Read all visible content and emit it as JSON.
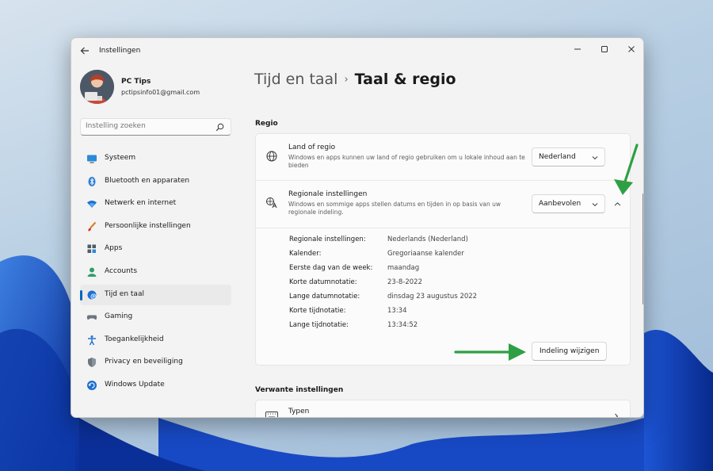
{
  "window": {
    "title": "Instellingen",
    "controls": [
      "minimize-icon",
      "maximize-icon",
      "close-icon"
    ]
  },
  "profile": {
    "name": "PC Tips",
    "email": "pctipsinfo01@gmail.com"
  },
  "search": {
    "placeholder": "Instelling zoeken"
  },
  "sidebar": {
    "items": [
      {
        "label": "Systeem",
        "icon": "monitor-icon",
        "active": false
      },
      {
        "label": "Bluetooth en apparaten",
        "icon": "bluetooth-icon",
        "active": false
      },
      {
        "label": "Netwerk en internet",
        "icon": "wifi-icon",
        "active": false
      },
      {
        "label": "Persoonlijke instellingen",
        "icon": "brush-icon",
        "active": false
      },
      {
        "label": "Apps",
        "icon": "apps-icon",
        "active": false
      },
      {
        "label": "Accounts",
        "icon": "person-icon",
        "active": false
      },
      {
        "label": "Tijd en taal",
        "icon": "globe-clock-icon",
        "active": true
      },
      {
        "label": "Gaming",
        "icon": "gamepad-icon",
        "active": false
      },
      {
        "label": "Toegankelijkheid",
        "icon": "accessibility-icon",
        "active": false
      },
      {
        "label": "Privacy en beveiliging",
        "icon": "shield-icon",
        "active": false
      },
      {
        "label": "Windows Update",
        "icon": "update-icon",
        "active": false
      }
    ]
  },
  "breadcrumb": {
    "parent": "Tijd en taal",
    "separator": "›",
    "current": "Taal & regio"
  },
  "regio": {
    "heading": "Regio",
    "land": {
      "title": "Land of regio",
      "description": "Windows en apps kunnen uw land of regio gebruiken om u lokale inhoud aan te bieden",
      "value": "Nederland"
    },
    "regional": {
      "title": "Regionale instellingen",
      "description": "Windows en sommige apps stellen datums en tijden in op basis van uw regionale indeling.",
      "value": "Aanbevolen",
      "details": [
        {
          "label": "Regionale instellingen:",
          "value": "Nederlands (Nederland)"
        },
        {
          "label": "Kalender:",
          "value": "Gregoriaanse kalender"
        },
        {
          "label": "Eerste dag van de week:",
          "value": "maandag"
        },
        {
          "label": "Korte datumnotatie:",
          "value": "23-8-2022"
        },
        {
          "label": "Lange datumnotatie:",
          "value": "dinsdag 23 augustus 2022"
        },
        {
          "label": "Korte tijdnotatie:",
          "value": "13:34"
        },
        {
          "label": "Lange tijdnotatie:",
          "value": "13:34:52"
        }
      ],
      "change_button": "Indeling wijzigen"
    }
  },
  "related": {
    "heading": "Verwante instellingen",
    "first_item": "Typen"
  },
  "colors": {
    "accent": "#0067c0",
    "annotation_arrow": "#2ea043"
  }
}
